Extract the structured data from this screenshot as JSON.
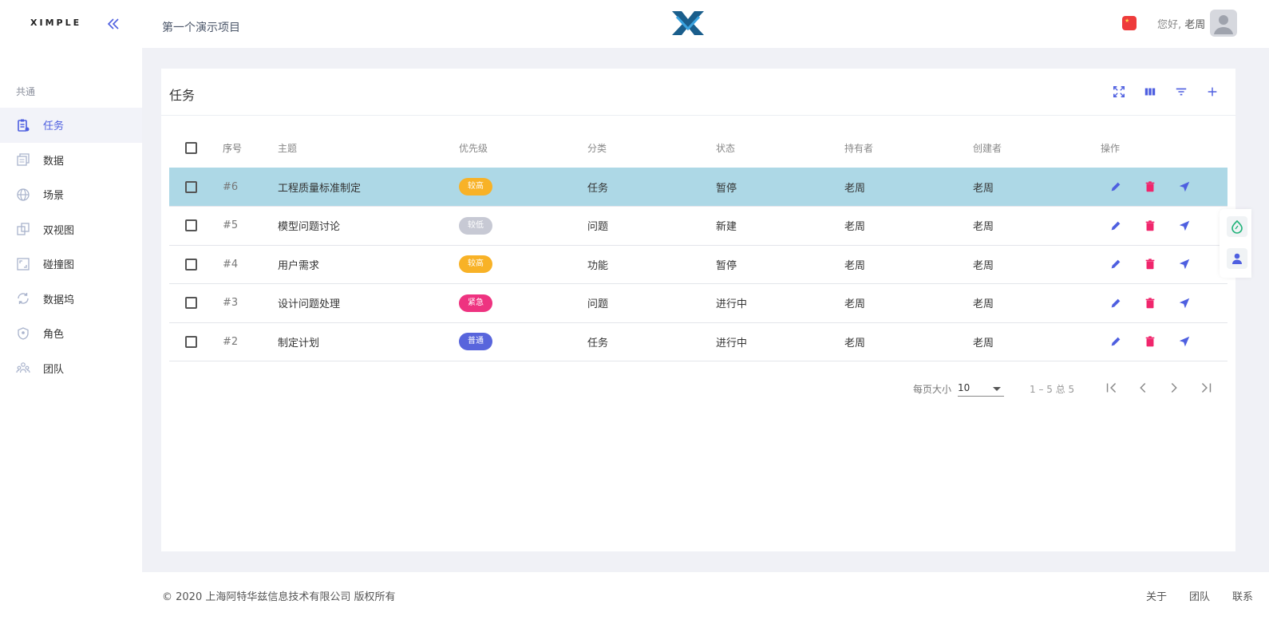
{
  "app": {
    "brand": "XIMPLE",
    "project_title": "第一个演示项目",
    "greeting_prefix": "您好,",
    "user_name": "老周"
  },
  "sidebar": {
    "section_title": "共通",
    "items": [
      {
        "label": "任务",
        "icon": "task-clipboard-icon",
        "active": true
      },
      {
        "label": "数据",
        "icon": "data-stack-icon"
      },
      {
        "label": "场景",
        "icon": "globe-icon"
      },
      {
        "label": "双视图",
        "icon": "dual-view-icon"
      },
      {
        "label": "碰撞图",
        "icon": "collision-frame-icon"
      },
      {
        "label": "数据坞",
        "icon": "sync-icon"
      },
      {
        "label": "角色",
        "icon": "shield-icon"
      },
      {
        "label": "团队",
        "icon": "team-icon"
      }
    ]
  },
  "card": {
    "title": "任务",
    "toolbar": [
      "fullscreen-icon",
      "columns-icon",
      "filter-icon",
      "add-icon"
    ]
  },
  "table": {
    "headers": {
      "id": "序号",
      "subject": "主题",
      "priority": "优先级",
      "category": "分类",
      "status": "状态",
      "owner": "持有者",
      "creator": "创建者",
      "actions": "操作"
    },
    "rows": [
      {
        "id": "#6",
        "subject": "工程质量标准制定",
        "priority": "较高",
        "priority_color": "#f8b227",
        "category": "任务",
        "status": "暂停",
        "owner": "老周",
        "creator": "老周",
        "selected": true
      },
      {
        "id": "#5",
        "subject": "模型问题讨论",
        "priority": "较低",
        "priority_color": "#c7c9d4",
        "category": "问题",
        "status": "新建",
        "owner": "老周",
        "creator": "老周"
      },
      {
        "id": "#4",
        "subject": "用户需求",
        "priority": "较高",
        "priority_color": "#f8b227",
        "category": "功能",
        "status": "暂停",
        "owner": "老周",
        "creator": "老周"
      },
      {
        "id": "#3",
        "subject": "设计问题处理",
        "priority": "紧急",
        "priority_color": "#ee3380",
        "category": "问题",
        "status": "进行中",
        "owner": "老周",
        "creator": "老周"
      },
      {
        "id": "#2",
        "subject": "制定计划",
        "priority": "普通",
        "priority_color": "#5865dc",
        "category": "任务",
        "status": "进行中",
        "owner": "老周",
        "creator": "老周"
      }
    ]
  },
  "pager": {
    "page_size_label": "每页大小",
    "page_size": "10",
    "range": "1 – 5 总 5"
  },
  "footer": {
    "copyright": "© 2020 上海阿特华兹信息技术有限公司 版权所有",
    "links": [
      "关于",
      "团队",
      "联系"
    ]
  },
  "colors": {
    "accent": "#4e5fe0",
    "selected_row": "#add8e6",
    "delete": "#f0266c",
    "logo": "#1a5e8c"
  }
}
